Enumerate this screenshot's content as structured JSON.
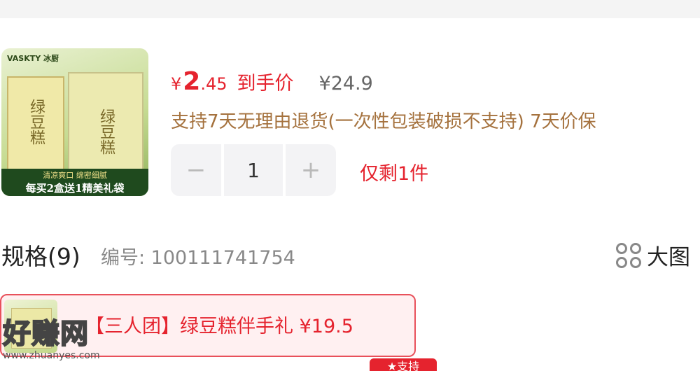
{
  "product": {
    "image": {
      "brand": "VASKTY 冰厨",
      "box_text_left": "绿豆糕",
      "box_text_right": "绿豆糕",
      "slogan": "清凉爽口 绵密细腻",
      "promo": "每买2盒送1精美礼袋"
    },
    "price": {
      "currency": "¥",
      "integer": "2",
      "decimal": ".45",
      "label": "到手价",
      "original": "¥24.9"
    },
    "service_text": "支持7天无理由退货(一次性包装破损不支持) 7天价保",
    "quantity": {
      "minus": "−",
      "value": "1",
      "plus": "+"
    },
    "stock_text": "仅剩1件"
  },
  "spec": {
    "title": "规格(9)",
    "code": "编号: 100111741754",
    "view_large_label": "大图"
  },
  "option": {
    "text": "【三人团】绿豆糕伴手礼  ¥19.5"
  },
  "watermark": {
    "main": "好赚网",
    "sub": "www.zhuanyes.com"
  },
  "badge": {
    "label": "★支持"
  },
  "colors": {
    "accent_red": "#e5232e",
    "service_brown": "#a5723e",
    "stepper_bg": "#f3f3f5"
  }
}
